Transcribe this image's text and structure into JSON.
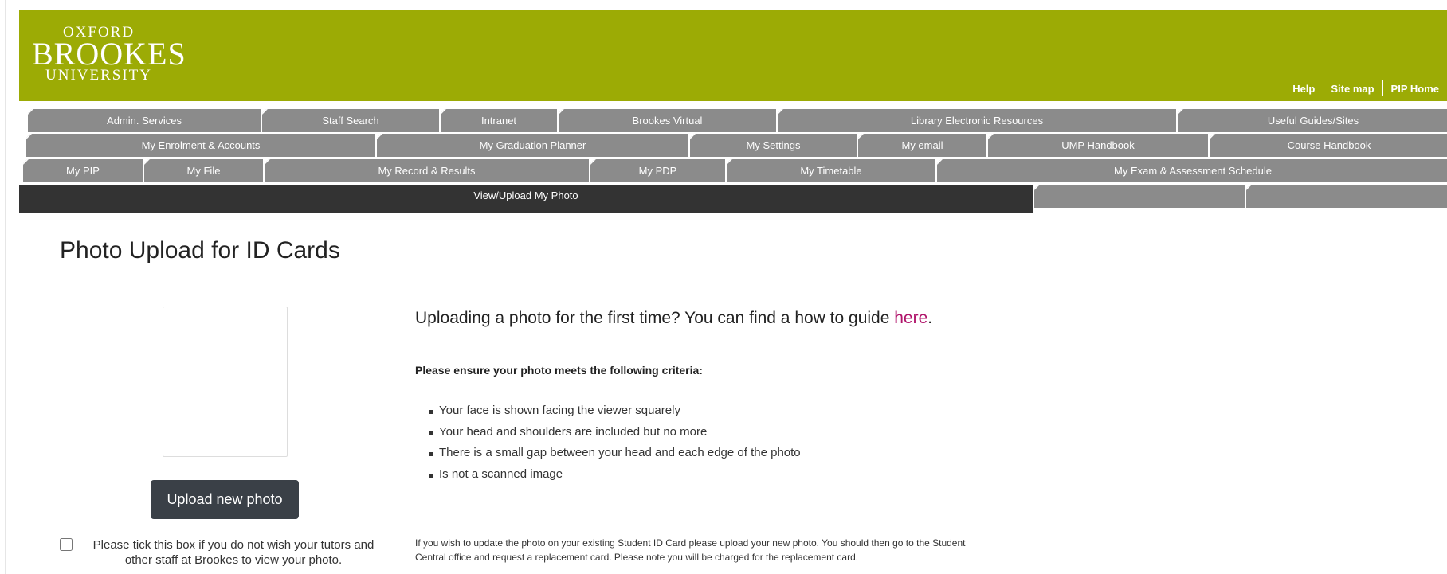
{
  "logo": {
    "line1": "OXFORD",
    "line2": "BROOKES",
    "line3": "UNIVERSITY"
  },
  "header_links": [
    "Help",
    "Site map",
    "PIP Home"
  ],
  "nav": {
    "row1": [
      "Admin. Services",
      "Staff Search",
      "Intranet",
      "Brookes Virtual",
      "Library Electronic Resources",
      "Useful Guides/Sites"
    ],
    "row2": [
      "My Enrolment & Accounts",
      "My Graduation Planner",
      "My Settings",
      "My email",
      "UMP Handbook",
      "Course Handbook"
    ],
    "row3": [
      "My PIP",
      "My File",
      "My Record & Results",
      "My PDP",
      "My Timetable",
      "My Exam & Assessment Schedule"
    ],
    "row4": [
      "View/Upload My Photo",
      "",
      ""
    ]
  },
  "main": {
    "title": "Photo Upload for ID Cards",
    "intro_text": "Uploading a photo for the first time? You can find a how to guide ",
    "intro_link": "here",
    "intro_end": ".",
    "criteria_heading": "Please ensure your photo meets the following criteria:",
    "criteria": [
      "Your face is shown facing the viewer squarely",
      "Your head and shoulders are included but no more",
      "There is a small gap between your head and each edge of the photo",
      "Is not a scanned image"
    ],
    "upload_button": "Upload new photo",
    "privacy_label": "Please tick this box if you do not wish your tutors and other staff at Brookes to view your photo.",
    "footnote": "If you wish to update the photo on your existing Student ID Card please upload your new photo. You should then go to the Student Central office and request a replacement card. Please note you will be charged for the replacement card."
  },
  "colors": {
    "header": "#9cab05",
    "tab": "#8b8b8b",
    "active_tab": "#333333",
    "link": "#b0136a",
    "button": "#3a4047"
  }
}
